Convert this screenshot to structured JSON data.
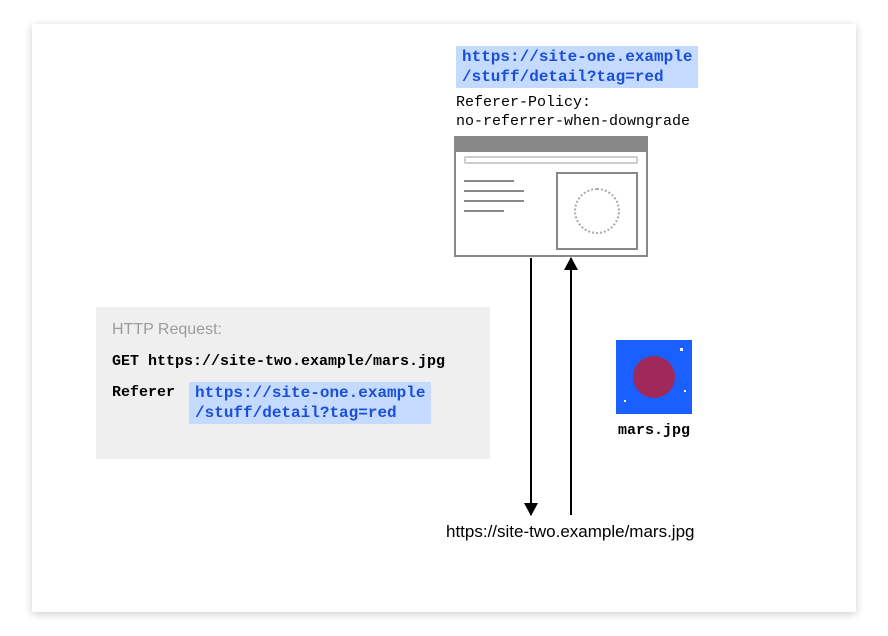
{
  "topUrl": {
    "line1": "https://site-one.example",
    "line2": "/stuff/detail?tag=red"
  },
  "refererPolicy": {
    "label": "Referer-Policy:",
    "value": "no-referrer-when-downgrade"
  },
  "httpRequest": {
    "label": "HTTP Request:",
    "getLine": "GET https://site-two.example/mars.jpg",
    "refererLabel": "Referer",
    "refererUrl": {
      "line1": "https://site-one.example",
      "line2": "/stuff/detail?tag=red"
    }
  },
  "marsImage": {
    "filename": "mars.jpg"
  },
  "bottomUrl": "https://site-two.example/mars.jpg"
}
